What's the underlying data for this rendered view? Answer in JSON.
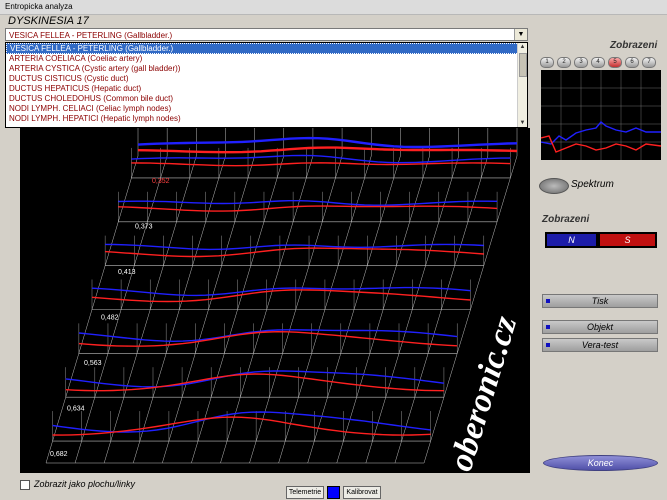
{
  "window": {
    "title": "Entropicka analyza"
  },
  "header": {
    "title": "DYSKINESIA  17"
  },
  "combo": {
    "selected": "VESICA  FELLEA  -  PETERLING  (Gallbladder.)"
  },
  "dropdown": {
    "items": [
      "VESICA  FELLEA  -  PETERLING  (Gallbladder.)",
      "ARTERIA  COELIACA  (Coeliac artery)",
      "ARTERIA  CYSTICA  (Cystic artery (gall bladder))",
      "DUCTUS  CISTICUS  (Cystic duct)",
      "DUCTUS  HEPATICUS  (Hepatic duct)",
      "DUCTUS  CHOLEDOHUS  (Common bile duct)",
      "NODI  LYMPH. CELIACI  (Celiac lymph nodes)",
      "NODI  LYMPH. HEPATICI  (Hepatic lymph nodes)"
    ]
  },
  "plot": {
    "row_values": [
      "0,352",
      "0,373",
      "0,413",
      "0,482",
      "0,563",
      "0,634",
      "0,682"
    ],
    "watermark": "oberonic.cz"
  },
  "right_panel": {
    "zobrazeni_top": "Zobrazeni",
    "mini_buttons": [
      "1",
      "2",
      "3",
      "4",
      "5",
      "6",
      "7"
    ],
    "spectrum": "Spektrum",
    "zobrazeni": "Zobrazeni",
    "n_label": "N",
    "s_label": "S",
    "tisk": "Tisk",
    "objekt": "Objekt",
    "vera": "Vera-test",
    "konec": "Konec"
  },
  "footer": {
    "checkbox_label": "Zobrazit jako plochu/linky",
    "telemetrie": "Telemetrie",
    "kalibrovat": "Kalibrovat"
  },
  "colors": {
    "red_series": "#ff2020",
    "blue_series": "#2020ff",
    "grid": "#bdbdbd",
    "ns_blue": "#1c1ca8",
    "ns_red": "#c01010"
  }
}
